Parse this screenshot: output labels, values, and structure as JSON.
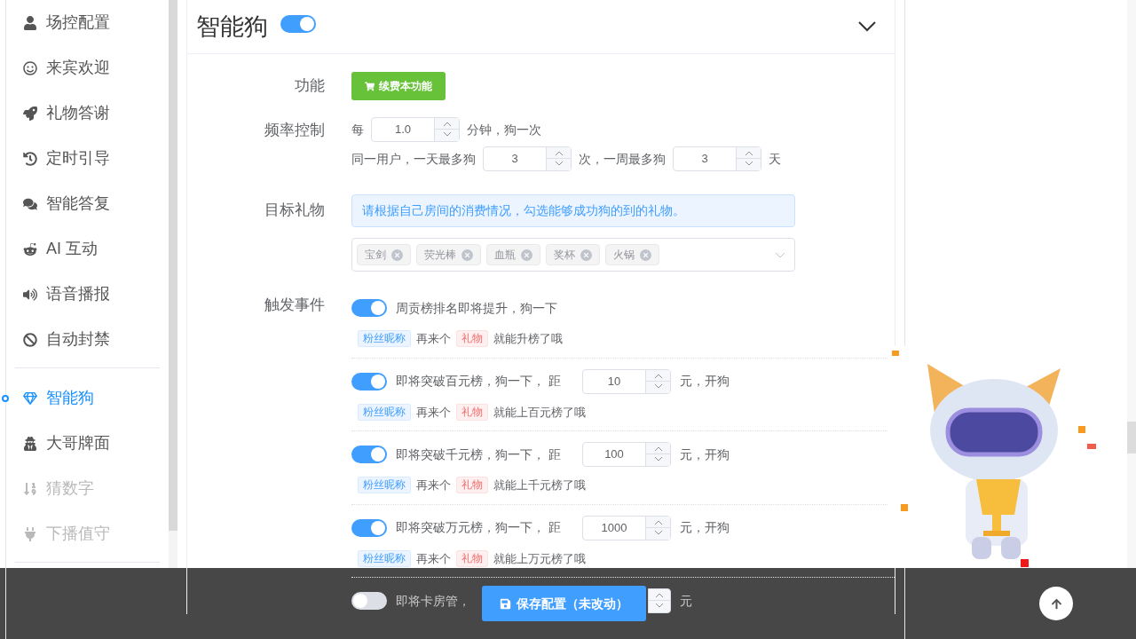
{
  "sidebar": {
    "sections": [
      {
        "items": [
          {
            "label": "场控配置",
            "selected": false,
            "disabled": false
          },
          {
            "label": "来宾欢迎",
            "selected": false,
            "disabled": false
          },
          {
            "label": "礼物答谢",
            "selected": false,
            "disabled": false
          },
          {
            "label": "定时引导",
            "selected": false,
            "disabled": false
          },
          {
            "label": "智能答复",
            "selected": false,
            "disabled": false
          },
          {
            "label": "AI 互动",
            "selected": false,
            "disabled": false
          },
          {
            "label": "语音播报",
            "selected": false,
            "disabled": false
          },
          {
            "label": "自动封禁",
            "selected": false,
            "disabled": false
          }
        ]
      },
      {
        "items": [
          {
            "label": "智能狗",
            "selected": true,
            "disabled": false
          },
          {
            "label": "大哥牌面",
            "selected": false,
            "disabled": false
          },
          {
            "label": "猜数字",
            "selected": false,
            "disabled": true
          },
          {
            "label": "下播值守",
            "selected": false,
            "disabled": true
          }
        ]
      }
    ]
  },
  "panel": {
    "title": "智能狗",
    "on": true,
    "expanded": true
  },
  "feature": {
    "label": "功能",
    "button": "续费本功能"
  },
  "frequency": {
    "label": "频率控制",
    "lines": [
      [
        {
          "kind": "text",
          "text": "每"
        },
        {
          "kind": "number",
          "value": "1.0"
        },
        {
          "kind": "text",
          "text": "分钟，狗一次"
        }
      ],
      [
        {
          "kind": "text",
          "text": "同一用户，一天最多狗"
        },
        {
          "kind": "number",
          "value": "3"
        },
        {
          "kind": "text",
          "text": "次，一周最多狗"
        },
        {
          "kind": "number",
          "value": "3"
        },
        {
          "kind": "text",
          "text": "天"
        }
      ]
    ]
  },
  "gifts": {
    "label": "目标礼物",
    "notice": "请根据自己房间的消费情况，勾选能够成功狗的到的礼物。",
    "tags": [
      "宝剑",
      "荧光棒",
      "血瓶",
      "奖杯",
      "火锅"
    ]
  },
  "events": {
    "label": "触发事件",
    "items": [
      {
        "on": true,
        "text": "周贡榜排名即将提升，狗一下",
        "template": [
          {
            "kind": "nick",
            "text": "粉丝昵称"
          },
          {
            "kind": "text",
            "text": "再来个"
          },
          {
            "kind": "gift",
            "text": "礼物"
          },
          {
            "kind": "text",
            "text": "就能升榜了哦"
          }
        ]
      },
      {
        "on": true,
        "text": "即将突破百元榜，狗一下， 距",
        "value": "10",
        "suffix": "元，开狗",
        "template": [
          {
            "kind": "nick",
            "text": "粉丝昵称"
          },
          {
            "kind": "text",
            "text": "再来个"
          },
          {
            "kind": "gift",
            "text": "礼物"
          },
          {
            "kind": "text",
            "text": "就能上百元榜了哦"
          }
        ]
      },
      {
        "on": true,
        "text": "即将突破千元榜，狗一下， 距",
        "value": "100",
        "suffix": "元，开狗",
        "template": [
          {
            "kind": "nick",
            "text": "粉丝昵称"
          },
          {
            "kind": "text",
            "text": "再来个"
          },
          {
            "kind": "gift",
            "text": "礼物"
          },
          {
            "kind": "text",
            "text": "就能上千元榜了哦"
          }
        ]
      },
      {
        "on": true,
        "text": "即将突破万元榜，狗一下， 距",
        "value": "1000",
        "suffix": "元，开狗",
        "template": [
          {
            "kind": "nick",
            "text": "粉丝昵称"
          },
          {
            "kind": "text",
            "text": "再来个"
          },
          {
            "kind": "gift",
            "text": "礼物"
          },
          {
            "kind": "text",
            "text": "就能上万元榜了哦"
          }
        ]
      },
      {
        "on": false,
        "text": "即将卡房管，",
        "value": "",
        "suffix": "元"
      }
    ]
  },
  "footer": {
    "save_button": "保存配置（未改动）"
  }
}
